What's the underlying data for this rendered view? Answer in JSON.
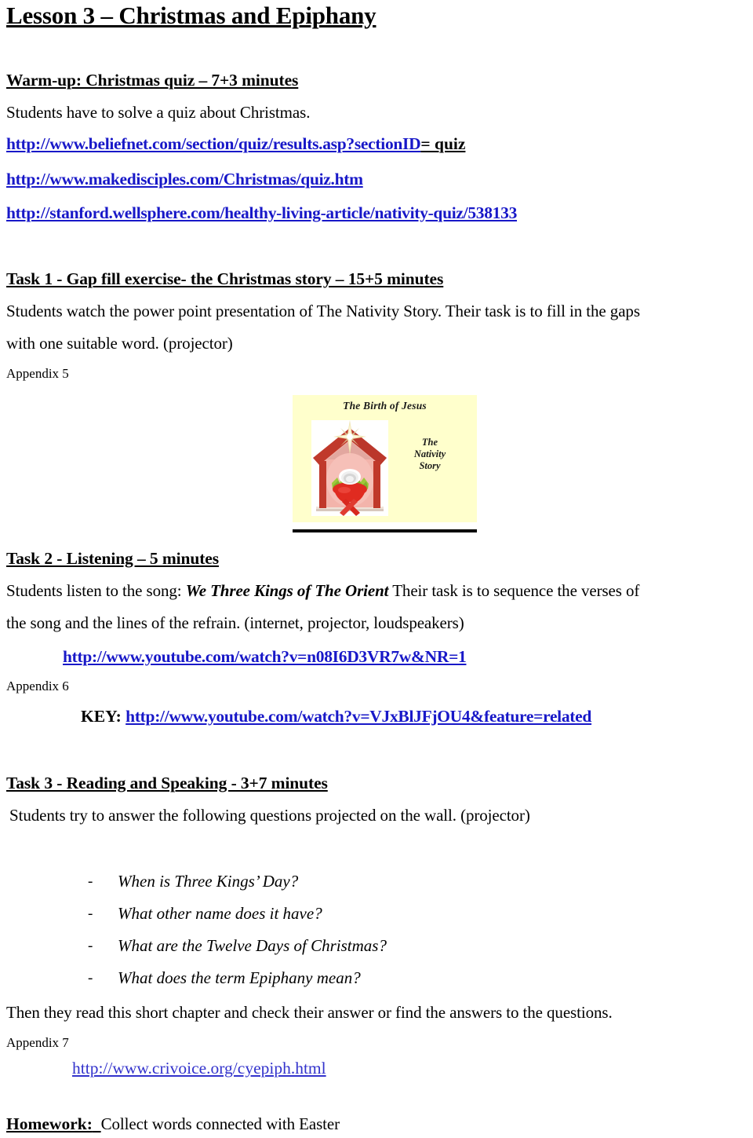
{
  "document": {
    "title": "Lesson 3 – Christmas and Epiphany"
  },
  "warmup": {
    "heading": "Warm-up: Christmas quiz – 7+3 minutes",
    "description": "Students have to solve a quiz about Christmas.",
    "links": [
      {
        "url": "http://www.beliefnet.com/section/quiz/results.asp?sectionID",
        "tail": "= quiz"
      },
      {
        "url": "http://www.makedisciples.com/Christmas/quiz.htm",
        "tail": ""
      },
      {
        "url": "http://stanford.wellsphere.com/healthy-living-article/nativity-quiz/538133",
        "tail": ""
      }
    ]
  },
  "task1": {
    "heading": "Task 1 - Gap fill exercise- the Christmas story – 15+5 minutes",
    "line1": "Students watch the power point presentation of The Nativity Story. Their task is to fill in the gaps",
    "line2": "with one suitable word. (projector)",
    "appendix": "Appendix 5",
    "slide": {
      "title": "The Birth of Jesus",
      "subtitle_line1": "The",
      "subtitle_line2": "Nativity",
      "subtitle_line3": "Story",
      "background_color": "#ffffcc",
      "roof_color": "#c0392b",
      "wall_color": "#f0a9a0",
      "manger_color": "#e02b20",
      "straw_color": "#8fbf3f",
      "star_color": "#e8d9a0"
    }
  },
  "task2": {
    "heading": "Task 2 - Listening – 5 minutes",
    "line1_pre": "Students listen to the song: ",
    "line1_song": "We Three Kings of The Orient",
    "line1_post": "  Their task is to sequence the verses of",
    "line2": "the song and the lines of the refrain. (internet, projector, loudspeakers)",
    "video_url": "http://www.youtube.com/watch?v=n08I6D3VR7w&NR=1",
    "appendix": "Appendix 6",
    "key_label": "KEY:",
    "key_url": "http://www.youtube.com/watch?v=VJxBlJFjOU4&feature=related"
  },
  "task3": {
    "heading": "Task 3 - Reading  and Speaking - 3+7 minutes",
    "intro": "Students try to answer the following questions projected on the wall. (projector)",
    "bullet": "-",
    "questions": [
      "When is Three Kings’ Day?",
      "What other name does it have?",
      "What are the Twelve Days of Christmas?",
      "What does the term Epiphany mean?"
    ],
    "closing": "Then they read this short chapter and check their answer or find the answers to the questions.",
    "appendix": "Appendix 7",
    "reading_url": "http://www.crivoice.org/cyepiph.html"
  },
  "homework": {
    "label": "Homework:",
    "text": "Collect words connected with Easter"
  },
  "colors": {
    "link": "#1818c8",
    "text": "#000000",
    "page_background": "#ffffff"
  }
}
